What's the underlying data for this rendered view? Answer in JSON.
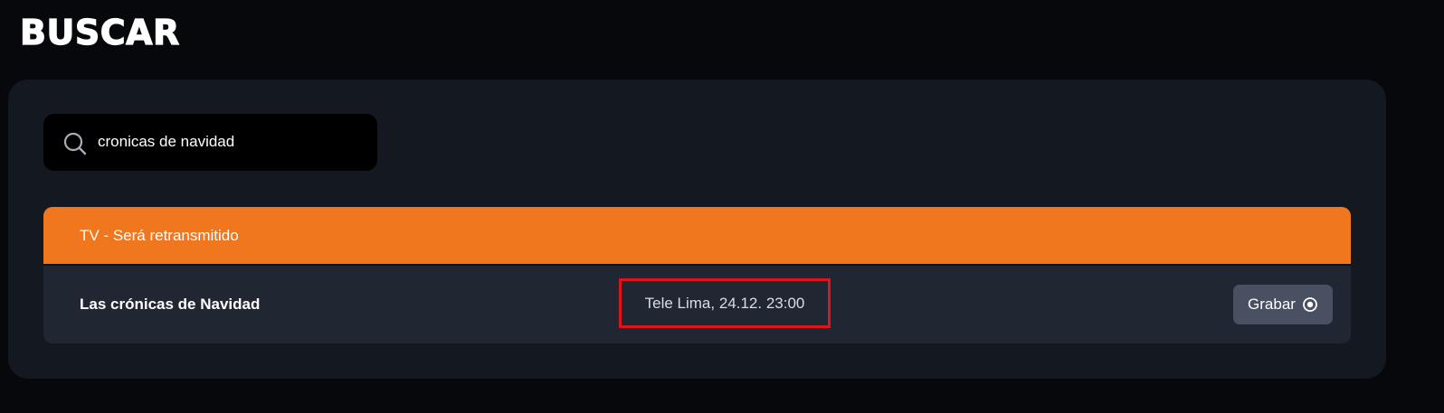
{
  "header": {
    "title": "BUSCAR"
  },
  "search": {
    "value": "cronicas de navidad",
    "icon": "search-icon"
  },
  "results": {
    "section_header": "TV - Será retransmitido",
    "accent_color": "#f0771d",
    "items": [
      {
        "title": "Las crónicas de Navidad",
        "schedule": "Tele Lima, 24.12. 23:00",
        "action_label": "Grabar",
        "action_icon": "record-icon"
      }
    ]
  },
  "highlight_color": "#e0141a"
}
